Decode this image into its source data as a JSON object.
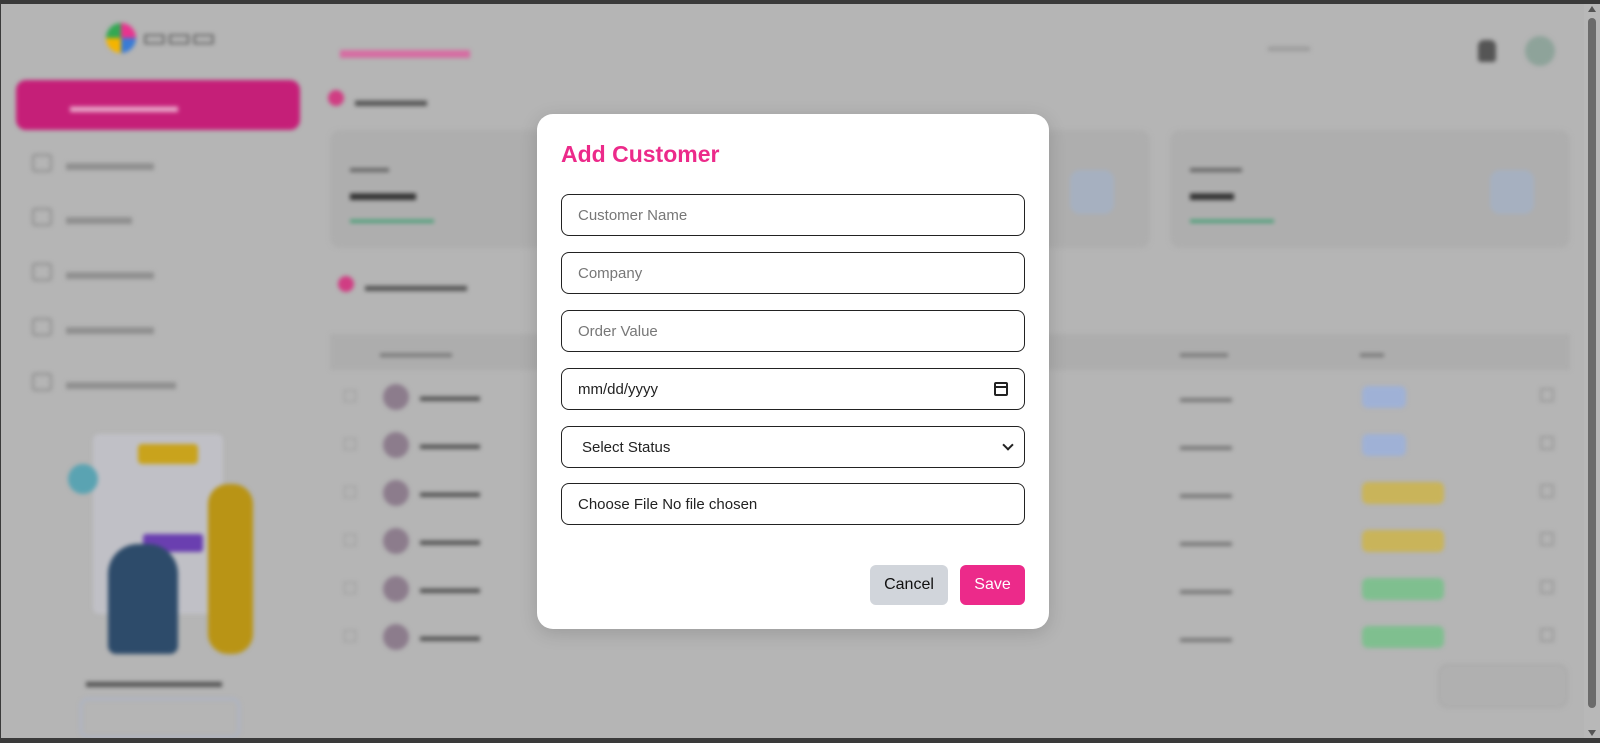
{
  "modal": {
    "title": "Add Customer",
    "fields": {
      "customer_name_placeholder": "Customer Name",
      "company_placeholder": "Company",
      "order_value_placeholder": "Order Value",
      "date_value": "mm/dd/yyyy",
      "status_selected": "Select Status",
      "file_label": "Choose File No file chosen"
    },
    "buttons": {
      "cancel": "Cancel",
      "save": "Save"
    }
  },
  "colors": {
    "accent": "#ec2a8a",
    "cancel_bg": "#d1d5db",
    "overlay": "#b5b5b5"
  },
  "icons": [
    "calendar-icon",
    "chevron-down-icon"
  ]
}
